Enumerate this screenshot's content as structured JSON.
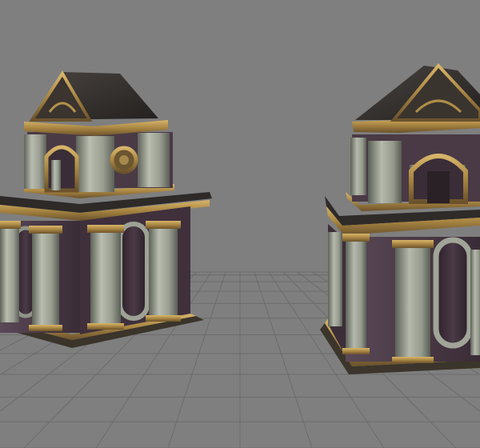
{
  "viewport": {
    "background_color": "#7f7f7f",
    "grid_line_color": "#6c6c6c",
    "grid_horizon_color": "#757575"
  },
  "models": [
    {
      "name": "building-left",
      "palette": {
        "column": "#a7ab9e",
        "column_shadow": "#6e7368",
        "wall": "#4a3a45",
        "niche": "#3e2e3b",
        "roof": "#2f2c2a",
        "gold": "#b4924b",
        "gold_dark": "#6f5630",
        "cornice": "#2e2b2a"
      }
    },
    {
      "name": "building-right",
      "palette": {
        "column": "#a3a89a",
        "column_shadow": "#6a6f64",
        "wall": "#4b3b46",
        "niche": "#3c2c39",
        "roof": "#2e2b29",
        "gold": "#b08e47",
        "gold_dark": "#6b532e",
        "cornice": "#2d2a29"
      }
    }
  ]
}
